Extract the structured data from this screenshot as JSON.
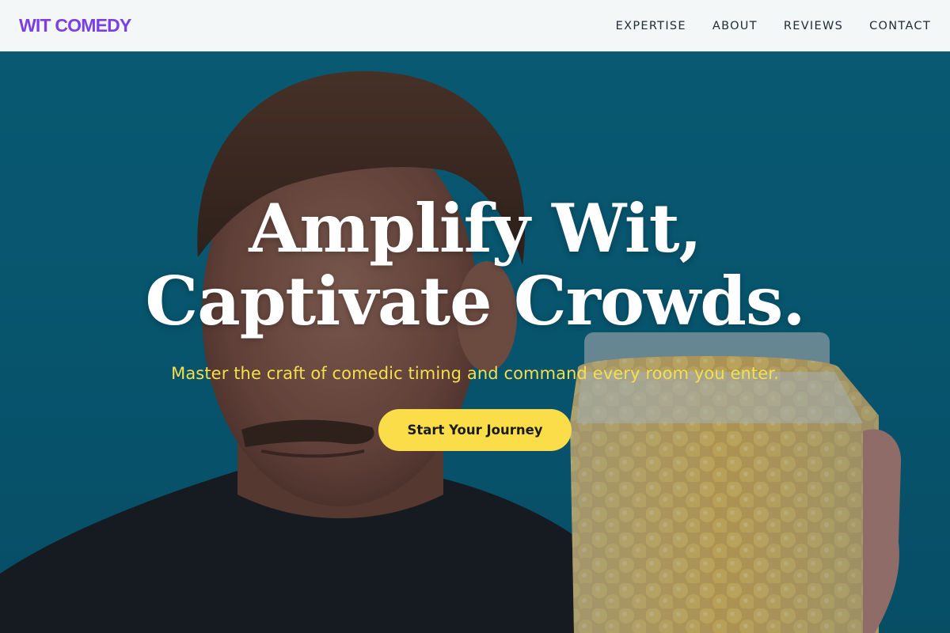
{
  "header": {
    "logo": "WIT COMEDY",
    "nav": [
      {
        "label": "EXPERTISE"
      },
      {
        "label": "ABOUT"
      },
      {
        "label": "REVIEWS"
      },
      {
        "label": "CONTACT"
      }
    ]
  },
  "hero": {
    "title_line1": "Amplify Wit,",
    "title_line2": "Captivate Crowds.",
    "subtitle": "Master the craft of comedic timing and command every room you enter.",
    "cta_label": "Start Your Journey",
    "image_icon": "hero-photo-man-with-candy-jar"
  },
  "colors": {
    "brand": "#7b3fe4",
    "accent": "#fbdd4a",
    "subtitle": "#f5df4d",
    "header_bg": "#f3f7f8",
    "hero_bg": "#0b6a85"
  }
}
